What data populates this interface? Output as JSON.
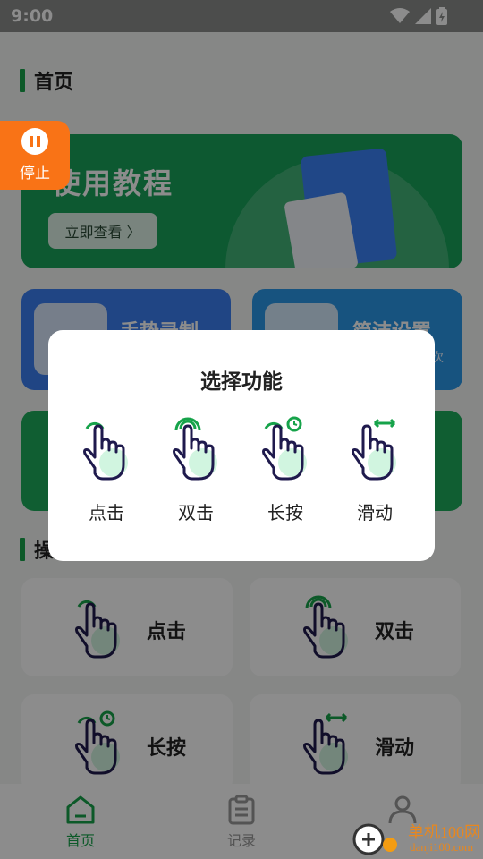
{
  "status_bar": {
    "time": "9:00"
  },
  "home": {
    "section_title": "首页",
    "banner": {
      "title": "使用教程",
      "button_label": "立即查看 〉"
    },
    "cards": [
      {
        "label": "手势录制",
        "color": "#3b7ef0"
      },
      {
        "label": "简洁设置",
        "sub": "次",
        "color": "#2a98e8"
      },
      {
        "label": "",
        "color": "#1eab5b"
      }
    ],
    "ops_section_title": "操",
    "ops": [
      {
        "label": "点击",
        "icon": "tap-hand-icon"
      },
      {
        "label": "双击",
        "icon": "double-tap-hand-icon"
      },
      {
        "label": "长按",
        "icon": "long-press-hand-icon"
      },
      {
        "label": "滑动",
        "icon": "swipe-hand-icon"
      }
    ]
  },
  "float_button": {
    "label": "停止",
    "icon": "pause-icon"
  },
  "dialog": {
    "title": "选择功能",
    "options": [
      {
        "label": "点击",
        "icon": "tap-hand-icon"
      },
      {
        "label": "双击",
        "icon": "double-tap-hand-icon"
      },
      {
        "label": "长按",
        "icon": "long-press-hand-icon"
      },
      {
        "label": "滑动",
        "icon": "swipe-hand-icon"
      }
    ]
  },
  "tabbar": {
    "tabs": [
      {
        "label": "首页",
        "icon": "home-icon",
        "active": true
      },
      {
        "label": "记录",
        "icon": "clipboard-icon",
        "active": false
      },
      {
        "label": "",
        "icon": "user-icon",
        "active": false
      }
    ]
  },
  "watermark": {
    "name": "单机100网",
    "url": "danji100.com"
  },
  "colors": {
    "accent": "#16a34a",
    "float": "#f97316",
    "hand_stroke": "#1f1a4d",
    "hand_fill": "#d1f5e0"
  }
}
